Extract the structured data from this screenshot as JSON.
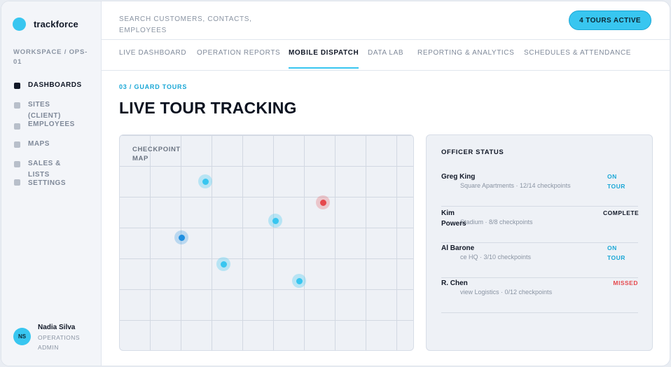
{
  "app": {
    "brand": "trackforce",
    "workspace": "WORKSPACE / OPS-01"
  },
  "sidebar": {
    "items": [
      {
        "label": "DASHBOARDS",
        "active": true
      },
      {
        "label": "SITES",
        "active": false
      },
      {
        "label": "(CLIENT) EMPLOYEES",
        "active": false
      },
      {
        "label": "MAPS",
        "active": false
      },
      {
        "label": "SALES &",
        "active": false
      },
      {
        "label": "LISTS SETTINGS",
        "active": false
      }
    ]
  },
  "user": {
    "initials": "NS",
    "name": "Nadia Silva",
    "role": "OPERATIONS ADMIN"
  },
  "header": {
    "search_placeholder": "SEARCH CUSTOMERS, CONTACTS, EMPLOYEES",
    "tours_badge": "4 TOURS ACTIVE"
  },
  "tabs": [
    {
      "label": "LIVE DASHBOARD",
      "active": false
    },
    {
      "label": "OPERATION REPORTS",
      "active": false
    },
    {
      "label": "MOBILE DISPATCH",
      "active": true
    },
    {
      "label": "DATA LAB",
      "active": false
    },
    {
      "label": "REPORTING & ANALYTICS",
      "active": false
    },
    {
      "label": "SCHEDULES & ATTENDANCE",
      "active": false
    }
  ],
  "main": {
    "breadcrumb": "03 / GUARD TOURS",
    "title": "LIVE TOUR TRACKING",
    "map_title": "CHECKPOINT MAP",
    "officer_panel_title": "OFFICER STATUS"
  },
  "officers": [
    {
      "name": "Greg King",
      "detail": "Square Apartments · 12/14 checkpoints",
      "status": "ON TOUR"
    },
    {
      "name": "Kim Powers",
      "detail": "Stadium · 8/8 checkpoints",
      "status": "COMPLETE"
    },
    {
      "name": "Al Barone",
      "detail": "ce HQ · 3/10 checkpoints",
      "status": "ON TOUR"
    },
    {
      "name": "R. Chen",
      "detail": "view Logistics · 0/12 checkpoints",
      "status": "MISSED"
    }
  ],
  "colors": {
    "accent": "#38c6f0",
    "pin_active": "#1f8fe0",
    "pin_missed": "#e5484d",
    "status_on_tour": "#1aa7d6",
    "status_missed": "#e5484d"
  }
}
